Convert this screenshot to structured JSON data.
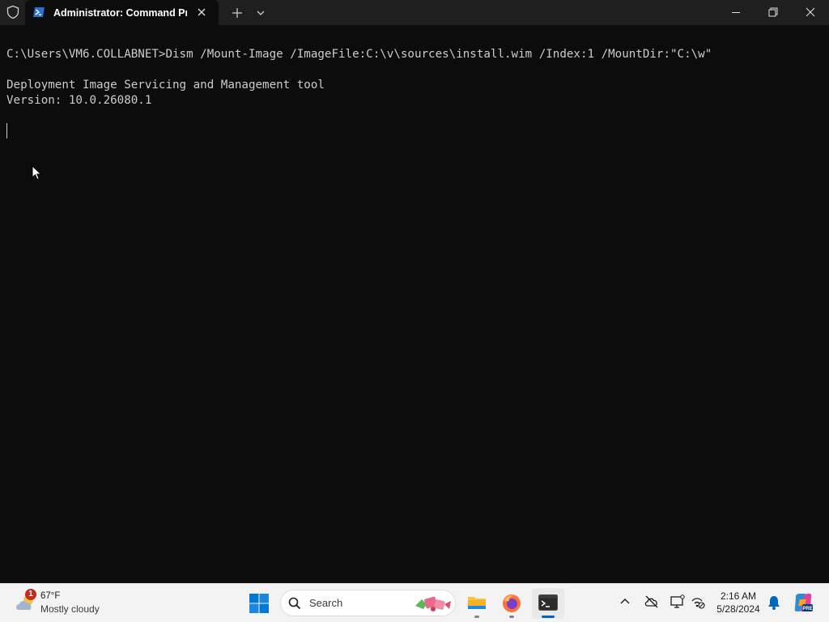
{
  "window": {
    "tab_title": "Administrator: Command Prc",
    "icons": {
      "shield": "shield-icon",
      "tab": "powershell-icon",
      "close_tab": "close-icon",
      "new_tab": "plus-icon",
      "dropdown": "chevron-down-icon",
      "minimize": "minimize-icon",
      "maximize": "restore-icon",
      "close": "close-icon"
    }
  },
  "console": {
    "lines": [
      "C:\\Users\\VM6.COLLABNET>Dism /Mount-Image /ImageFile:C:\\v\\sources\\install.wim /Index:1 /MountDir:\"C:\\w\"",
      "",
      "Deployment Image Servicing and Management tool",
      "Version: 10.0.26080.1"
    ],
    "colors": {
      "background": "#0c0c0c",
      "text": "#cccccc"
    }
  },
  "taskbar": {
    "weather": {
      "badge": "1",
      "temp": "67°F",
      "desc": "Mostly cloudy",
      "icon": "cloud-icon"
    },
    "search": {
      "label": "Search",
      "icon": "search-icon"
    },
    "apps": [
      {
        "name": "file-explorer",
        "icon": "folder-icon"
      },
      {
        "name": "firefox",
        "icon": "firefox-icon"
      },
      {
        "name": "terminal",
        "icon": "terminal-icon",
        "active": true
      }
    ],
    "tray": [
      "chevron-up-icon",
      "cloud-offline-icon",
      "display-icon",
      "network-icon"
    ],
    "clock": {
      "time": "2:16 AM",
      "date": "5/28/2024"
    },
    "notification_icon": "bell-icon",
    "copilot_icon": "copilot-icon",
    "accent": "#0067c0"
  }
}
